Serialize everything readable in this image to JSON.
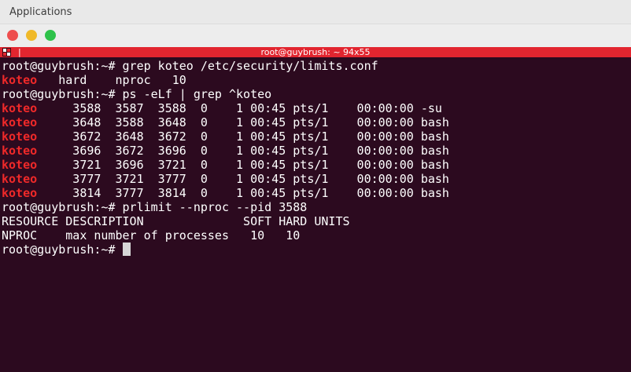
{
  "system": {
    "menu_label": "Applications"
  },
  "window": {
    "title": "root@guybrush: ~ 94x55"
  },
  "colors": {
    "terminal_bg": "#2c0a1f",
    "tab_red": "#e2252f",
    "user_red": "#ef2929"
  },
  "terminal": {
    "prompt": "root@guybrush:~#",
    "cmd1": " grep koteo /etc/security/limits.conf",
    "limits_line": {
      "user": "koteo",
      "rest": "   hard    nproc   10"
    },
    "cmd2": " ps -eLf | grep ^koteo",
    "processes": [
      {
        "user": "koteo",
        "rest": "     3588  3587  3588  0    1 00:45 pts/1    00:00:00 -su"
      },
      {
        "user": "koteo",
        "rest": "     3648  3588  3648  0    1 00:45 pts/1    00:00:00 bash"
      },
      {
        "user": "koteo",
        "rest": "     3672  3648  3672  0    1 00:45 pts/1    00:00:00 bash"
      },
      {
        "user": "koteo",
        "rest": "     3696  3672  3696  0    1 00:45 pts/1    00:00:00 bash"
      },
      {
        "user": "koteo",
        "rest": "     3721  3696  3721  0    1 00:45 pts/1    00:00:00 bash"
      },
      {
        "user": "koteo",
        "rest": "     3777  3721  3777  0    1 00:45 pts/1    00:00:00 bash"
      },
      {
        "user": "koteo",
        "rest": "     3814  3777  3814  0    1 00:45 pts/1    00:00:00 bash"
      }
    ],
    "cmd3": " prlimit --nproc --pid 3588",
    "table_header": "RESOURCE DESCRIPTION              SOFT HARD UNITS",
    "table_row": "NPROC    max number of processes   10   10"
  }
}
